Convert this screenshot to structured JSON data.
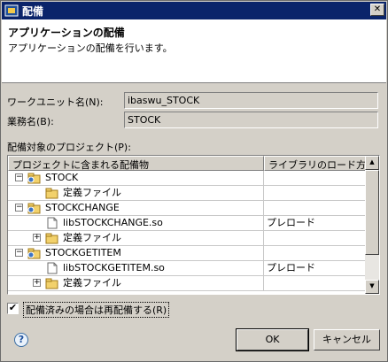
{
  "window": {
    "title": "配備",
    "close_glyph": "✕"
  },
  "header": {
    "title": "アプリケーションの配備",
    "description": "アプリケーションの配備を行います。"
  },
  "fields": {
    "work_unit": {
      "label": "ワークユニット名(N):",
      "value": "ibaswu_STOCK"
    },
    "business": {
      "label": "業務名(B):",
      "value": "STOCK"
    }
  },
  "projects": {
    "label": "配備対象のプロジェクト(P):",
    "columns": [
      "プロジェクトに含まれる配備物",
      "ライブラリのロード方法"
    ],
    "rows": [
      {
        "label": "STOCK",
        "type": "project",
        "expander": "−",
        "load": ""
      },
      {
        "label": "定義ファイル",
        "type": "folder",
        "expander": "",
        "load": ""
      },
      {
        "label": "STOCKCHANGE",
        "type": "project",
        "expander": "−",
        "load": ""
      },
      {
        "label": "libSTOCKCHANGE.so",
        "type": "file",
        "expander": "",
        "load": "プレロード"
      },
      {
        "label": "定義ファイル",
        "type": "folder",
        "expander": "+",
        "load": ""
      },
      {
        "label": "STOCKGETITEM",
        "type": "project",
        "expander": "−",
        "load": ""
      },
      {
        "label": "libSTOCKGETITEM.so",
        "type": "file",
        "expander": "",
        "load": "プレロード"
      },
      {
        "label": "定義ファイル",
        "type": "folder",
        "expander": "+",
        "load": ""
      }
    ]
  },
  "redeploy": {
    "label": "配備済みの場合は再配備する(R)",
    "checked": "✔"
  },
  "buttons": {
    "help": "?",
    "ok": "OK",
    "cancel": "キャンセル"
  }
}
